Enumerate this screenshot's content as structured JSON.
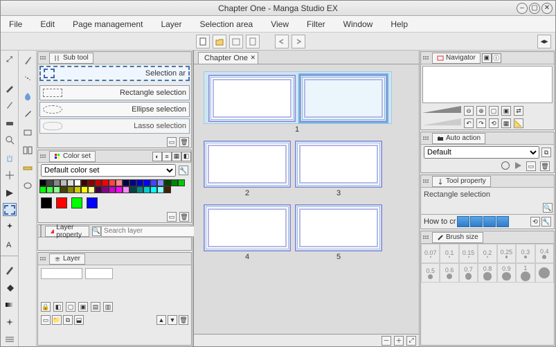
{
  "title": "Chapter One - Manga Studio EX",
  "menu": [
    "File",
    "Edit",
    "Page management",
    "Layer",
    "Selection area",
    "View",
    "Filter",
    "Window",
    "Help"
  ],
  "subtool": {
    "tab": "Sub tool",
    "selected": "Selection ar",
    "items": [
      "Rectangle selection",
      "Ellipse selection",
      "Lasso selection"
    ]
  },
  "colorset": {
    "tab": "Color set",
    "selected": "Default color set"
  },
  "layerprop": {
    "tab": "Layer property",
    "search_placeholder": "Search layer"
  },
  "layer": {
    "tab": "Layer"
  },
  "canvas": {
    "tab": "Chapter One",
    "pages": [
      1,
      2,
      3,
      4,
      5
    ]
  },
  "navigator": {
    "tab": "Navigator"
  },
  "autoaction": {
    "tab": "Auto action",
    "selected": "Default"
  },
  "toolprop": {
    "tab": "Tool property",
    "value": "Rectangle selection",
    "howto": "How to cr"
  },
  "brush": {
    "tab": "Brush size",
    "sizes": [
      0.07,
      0.1,
      0.15,
      0.2,
      0.25,
      0.3,
      0.4,
      0.5,
      0.6,
      0.7,
      0.8,
      0.9,
      1
    ]
  },
  "swatches": [
    "#000",
    "#444",
    "#888",
    "#bbb",
    "#ddd",
    "#fff",
    "#400",
    "#800",
    "#c00",
    "#f00",
    "#f44",
    "#f88",
    "#004",
    "#008",
    "#00c",
    "#00f",
    "#44f",
    "#88f",
    "#040",
    "#080",
    "#0c0",
    "#0f0",
    "#4f4",
    "#8f8",
    "#440",
    "#880",
    "#cc0",
    "#ff0",
    "#ff8",
    "#404",
    "#808",
    "#c0c",
    "#f0f",
    "#f8f",
    "#044",
    "#088",
    "#0cc",
    "#0ff",
    "#8ff",
    "#420"
  ],
  "bigs": [
    "#000",
    "#f00",
    "#0f0",
    "#00f"
  ]
}
